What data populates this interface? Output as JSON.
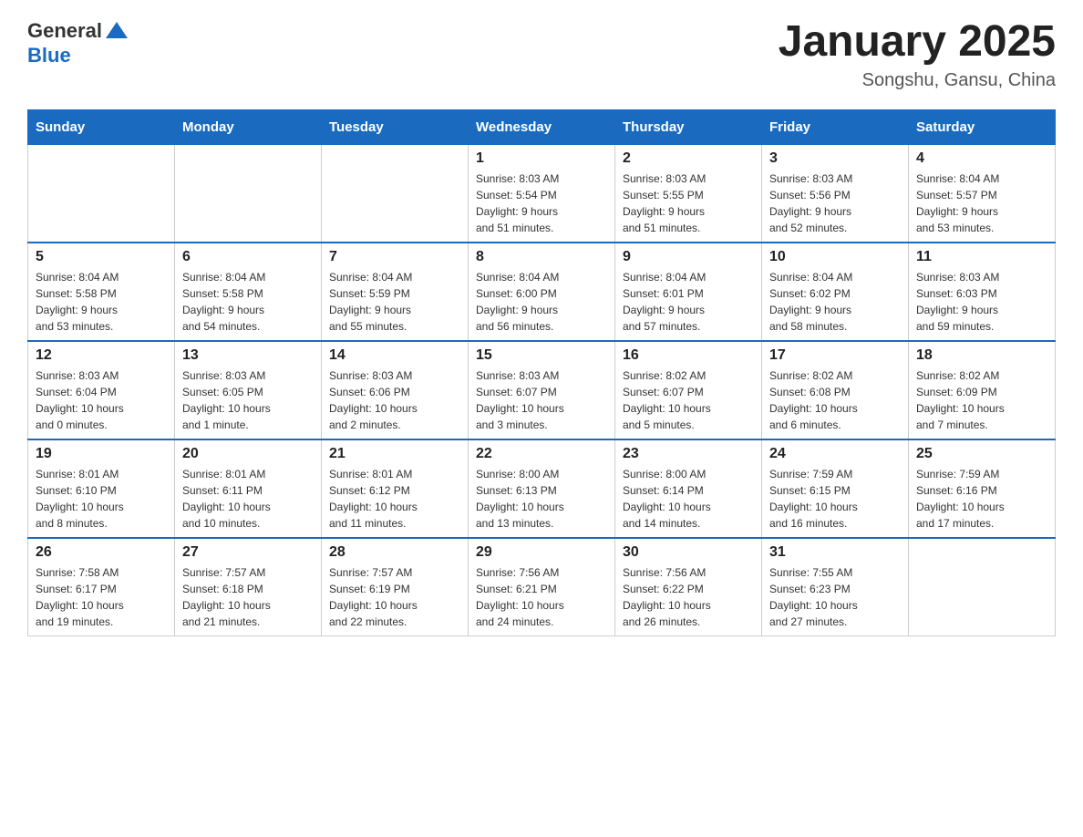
{
  "header": {
    "logo": {
      "general": "General",
      "blue": "Blue"
    },
    "title": "January 2025",
    "location": "Songshu, Gansu, China"
  },
  "columns": [
    "Sunday",
    "Monday",
    "Tuesday",
    "Wednesday",
    "Thursday",
    "Friday",
    "Saturday"
  ],
  "weeks": [
    [
      {
        "day": "",
        "info": ""
      },
      {
        "day": "",
        "info": ""
      },
      {
        "day": "",
        "info": ""
      },
      {
        "day": "1",
        "info": "Sunrise: 8:03 AM\nSunset: 5:54 PM\nDaylight: 9 hours\nand 51 minutes."
      },
      {
        "day": "2",
        "info": "Sunrise: 8:03 AM\nSunset: 5:55 PM\nDaylight: 9 hours\nand 51 minutes."
      },
      {
        "day": "3",
        "info": "Sunrise: 8:03 AM\nSunset: 5:56 PM\nDaylight: 9 hours\nand 52 minutes."
      },
      {
        "day": "4",
        "info": "Sunrise: 8:04 AM\nSunset: 5:57 PM\nDaylight: 9 hours\nand 53 minutes."
      }
    ],
    [
      {
        "day": "5",
        "info": "Sunrise: 8:04 AM\nSunset: 5:58 PM\nDaylight: 9 hours\nand 53 minutes."
      },
      {
        "day": "6",
        "info": "Sunrise: 8:04 AM\nSunset: 5:58 PM\nDaylight: 9 hours\nand 54 minutes."
      },
      {
        "day": "7",
        "info": "Sunrise: 8:04 AM\nSunset: 5:59 PM\nDaylight: 9 hours\nand 55 minutes."
      },
      {
        "day": "8",
        "info": "Sunrise: 8:04 AM\nSunset: 6:00 PM\nDaylight: 9 hours\nand 56 minutes."
      },
      {
        "day": "9",
        "info": "Sunrise: 8:04 AM\nSunset: 6:01 PM\nDaylight: 9 hours\nand 57 minutes."
      },
      {
        "day": "10",
        "info": "Sunrise: 8:04 AM\nSunset: 6:02 PM\nDaylight: 9 hours\nand 58 minutes."
      },
      {
        "day": "11",
        "info": "Sunrise: 8:03 AM\nSunset: 6:03 PM\nDaylight: 9 hours\nand 59 minutes."
      }
    ],
    [
      {
        "day": "12",
        "info": "Sunrise: 8:03 AM\nSunset: 6:04 PM\nDaylight: 10 hours\nand 0 minutes."
      },
      {
        "day": "13",
        "info": "Sunrise: 8:03 AM\nSunset: 6:05 PM\nDaylight: 10 hours\nand 1 minute."
      },
      {
        "day": "14",
        "info": "Sunrise: 8:03 AM\nSunset: 6:06 PM\nDaylight: 10 hours\nand 2 minutes."
      },
      {
        "day": "15",
        "info": "Sunrise: 8:03 AM\nSunset: 6:07 PM\nDaylight: 10 hours\nand 3 minutes."
      },
      {
        "day": "16",
        "info": "Sunrise: 8:02 AM\nSunset: 6:07 PM\nDaylight: 10 hours\nand 5 minutes."
      },
      {
        "day": "17",
        "info": "Sunrise: 8:02 AM\nSunset: 6:08 PM\nDaylight: 10 hours\nand 6 minutes."
      },
      {
        "day": "18",
        "info": "Sunrise: 8:02 AM\nSunset: 6:09 PM\nDaylight: 10 hours\nand 7 minutes."
      }
    ],
    [
      {
        "day": "19",
        "info": "Sunrise: 8:01 AM\nSunset: 6:10 PM\nDaylight: 10 hours\nand 8 minutes."
      },
      {
        "day": "20",
        "info": "Sunrise: 8:01 AM\nSunset: 6:11 PM\nDaylight: 10 hours\nand 10 minutes."
      },
      {
        "day": "21",
        "info": "Sunrise: 8:01 AM\nSunset: 6:12 PM\nDaylight: 10 hours\nand 11 minutes."
      },
      {
        "day": "22",
        "info": "Sunrise: 8:00 AM\nSunset: 6:13 PM\nDaylight: 10 hours\nand 13 minutes."
      },
      {
        "day": "23",
        "info": "Sunrise: 8:00 AM\nSunset: 6:14 PM\nDaylight: 10 hours\nand 14 minutes."
      },
      {
        "day": "24",
        "info": "Sunrise: 7:59 AM\nSunset: 6:15 PM\nDaylight: 10 hours\nand 16 minutes."
      },
      {
        "day": "25",
        "info": "Sunrise: 7:59 AM\nSunset: 6:16 PM\nDaylight: 10 hours\nand 17 minutes."
      }
    ],
    [
      {
        "day": "26",
        "info": "Sunrise: 7:58 AM\nSunset: 6:17 PM\nDaylight: 10 hours\nand 19 minutes."
      },
      {
        "day": "27",
        "info": "Sunrise: 7:57 AM\nSunset: 6:18 PM\nDaylight: 10 hours\nand 21 minutes."
      },
      {
        "day": "28",
        "info": "Sunrise: 7:57 AM\nSunset: 6:19 PM\nDaylight: 10 hours\nand 22 minutes."
      },
      {
        "day": "29",
        "info": "Sunrise: 7:56 AM\nSunset: 6:21 PM\nDaylight: 10 hours\nand 24 minutes."
      },
      {
        "day": "30",
        "info": "Sunrise: 7:56 AM\nSunset: 6:22 PM\nDaylight: 10 hours\nand 26 minutes."
      },
      {
        "day": "31",
        "info": "Sunrise: 7:55 AM\nSunset: 6:23 PM\nDaylight: 10 hours\nand 27 minutes."
      },
      {
        "day": "",
        "info": ""
      }
    ]
  ]
}
